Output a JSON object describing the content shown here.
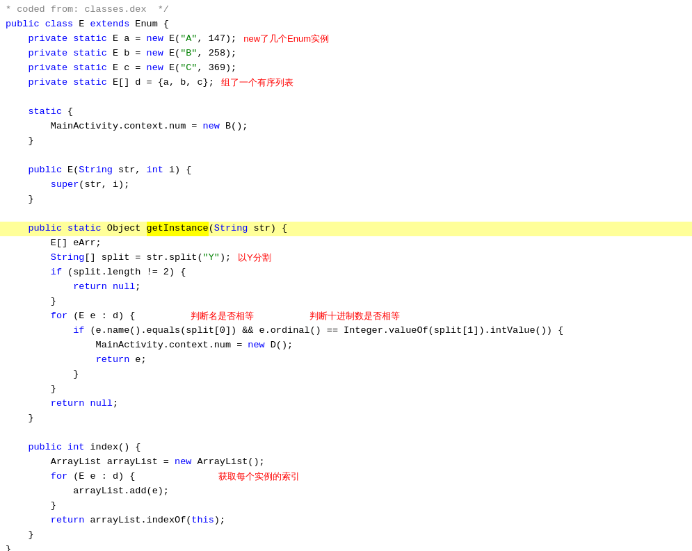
{
  "header_comment": "* coded from: classes.dex  */",
  "lines": [
    {
      "id": "L0",
      "content": "header",
      "highlighted": false
    },
    {
      "id": "L1",
      "content": "class_decl",
      "highlighted": false
    },
    {
      "id": "L2",
      "content": "field_a",
      "highlighted": false,
      "annotation": "new了几个Enum实例"
    },
    {
      "id": "L3",
      "content": "field_b",
      "highlighted": false
    },
    {
      "id": "L4",
      "content": "field_c",
      "highlighted": false
    },
    {
      "id": "L5",
      "content": "field_d",
      "highlighted": false,
      "annotation": "组了一个有序列表"
    },
    {
      "id": "L6",
      "content": "blank",
      "highlighted": false
    },
    {
      "id": "L7",
      "content": "static_open",
      "highlighted": false
    },
    {
      "id": "L8",
      "content": "static_body",
      "highlighted": false
    },
    {
      "id": "L9",
      "content": "static_close",
      "highlighted": false
    },
    {
      "id": "L10",
      "content": "blank2",
      "highlighted": false
    },
    {
      "id": "L11",
      "content": "constructor_decl",
      "highlighted": false
    },
    {
      "id": "L12",
      "content": "super_call",
      "highlighted": false
    },
    {
      "id": "L13",
      "content": "constructor_close",
      "highlighted": false
    },
    {
      "id": "L14",
      "content": "blank3",
      "highlighted": false
    },
    {
      "id": "L15",
      "content": "getinstance_decl",
      "highlighted": true
    },
    {
      "id": "L16",
      "content": "earr_decl",
      "highlighted": false
    },
    {
      "id": "L17",
      "content": "split_decl",
      "highlighted": false,
      "annotation": "以Y分割"
    },
    {
      "id": "L18",
      "content": "if_split",
      "highlighted": false
    },
    {
      "id": "L19",
      "content": "return_null1",
      "highlighted": false
    },
    {
      "id": "L20",
      "content": "close1",
      "highlighted": false
    },
    {
      "id": "L21",
      "content": "for_loop",
      "highlighted": false,
      "annotation1": "判断名是否相等",
      "annotation2": "判断十进制数是否相等"
    },
    {
      "id": "L22",
      "content": "if_equals",
      "highlighted": false
    },
    {
      "id": "L23",
      "content": "context_num_d",
      "highlighted": false
    },
    {
      "id": "L24",
      "content": "return_e",
      "highlighted": false
    },
    {
      "id": "L25",
      "content": "close2",
      "highlighted": false
    },
    {
      "id": "L26",
      "content": "close3",
      "highlighted": false
    },
    {
      "id": "L27",
      "content": "return_null2",
      "highlighted": false
    },
    {
      "id": "L28",
      "content": "getinstance_close",
      "highlighted": false
    },
    {
      "id": "L29",
      "content": "blank4",
      "highlighted": false
    },
    {
      "id": "L30",
      "content": "index_decl",
      "highlighted": false
    },
    {
      "id": "L31",
      "content": "arraylist_decl",
      "highlighted": false
    },
    {
      "id": "L32",
      "content": "for_loop2",
      "highlighted": false,
      "annotation": "获取每个实例的索引"
    },
    {
      "id": "L33",
      "content": "arraylist_add",
      "highlighted": false
    },
    {
      "id": "L34",
      "content": "close4",
      "highlighted": false
    },
    {
      "id": "L35",
      "content": "return_indexof",
      "highlighted": false
    },
    {
      "id": "L36",
      "content": "index_close",
      "highlighted": false
    }
  ],
  "annotations": {
    "new_enum": "new了几个Enum实例",
    "ordered_list": "组了一个有序列表",
    "split_y": "以Y分割",
    "check_name": "判断名是否相等",
    "check_decimal": "判断十进制数是否相等",
    "get_index": "获取每个实例的索引"
  }
}
